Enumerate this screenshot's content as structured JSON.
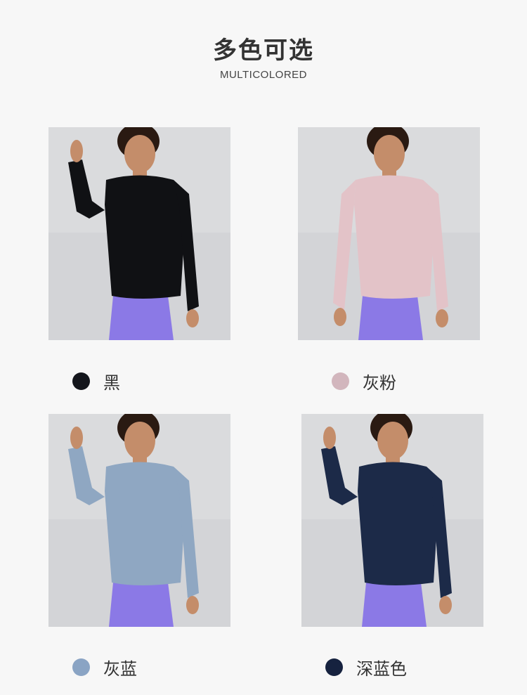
{
  "header": {
    "title": "多色可选",
    "subtitle": "MULTICOLORED"
  },
  "colors": [
    {
      "name": "黑",
      "swatch": "#14161c",
      "shirt": "#101114"
    },
    {
      "name": "灰粉",
      "swatch": "#d2b6bd",
      "shirt": "#e3c3c8"
    },
    {
      "name": "灰蓝",
      "swatch": "#8aa4c4",
      "shirt": "#8fa7c2"
    },
    {
      "name": "深蓝色",
      "swatch": "#16223f",
      "shirt": "#1c2a48"
    }
  ],
  "legging_color": "#8b79e6"
}
